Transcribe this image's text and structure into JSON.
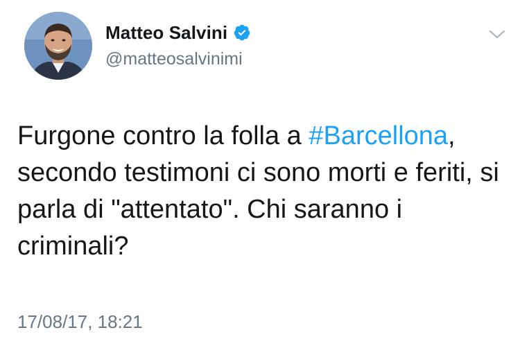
{
  "author": {
    "display_name": "Matteo Salvini",
    "handle": "@matteosalvinimi",
    "verified": true
  },
  "tweet": {
    "text_before_hashtag": "Furgone contro la folla a ",
    "hashtag": "#Barcellona",
    "text_after_hashtag": ", secondo testimoni ci sono morti e feriti, si parla di \"attentato\". Chi saranno i criminali?"
  },
  "timestamp": "17/08/17, 18:21",
  "icons": {
    "verified": "verified-badge-icon",
    "menu": "chevron-down-icon"
  },
  "colors": {
    "link": "#1da1f2",
    "verified_badge": "#1da1f2",
    "secondary_text": "#657786",
    "primary_text": "#14171a"
  }
}
